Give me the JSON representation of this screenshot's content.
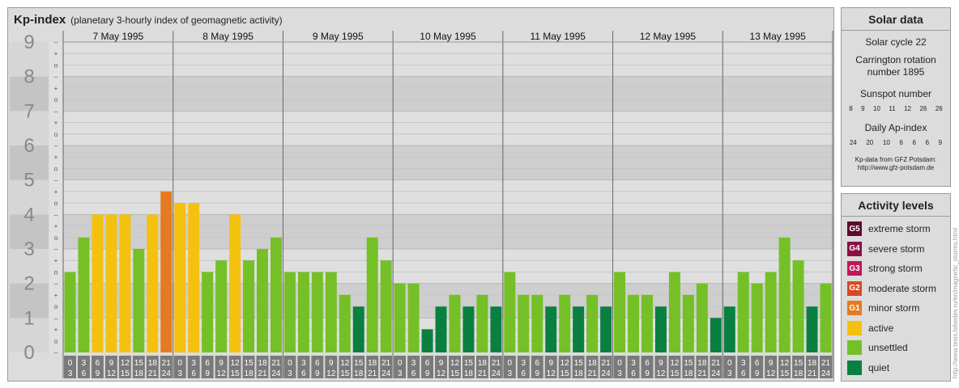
{
  "header": {
    "title": "Kp-index",
    "subtitle": "(planetary 3-hourly index of geomagnetic activity)"
  },
  "solar": {
    "title": "Solar data",
    "solar_cycle": "Solar cycle 22",
    "carrington": "Carrington rotation number 1895",
    "sunspot_label": "Sunspot number",
    "sunspot_values": [
      "8",
      "9",
      "10",
      "11",
      "12",
      "26",
      "26"
    ],
    "ap_label": "Daily Ap-index",
    "ap_values": [
      "24",
      "20",
      "10",
      "6",
      "6",
      "6",
      "9"
    ],
    "credit_1": "Kp-data from GFZ Potsdam:",
    "credit_2": "http://www.gfz-potsdam.de"
  },
  "activity": {
    "title": "Activity levels",
    "levels": [
      {
        "badge": "G5",
        "label": "extreme storm",
        "color": "#5c0a2e"
      },
      {
        "badge": "G4",
        "label": "severe storm",
        "color": "#8c1048"
      },
      {
        "badge": "G3",
        "label": "strong storm",
        "color": "#c0175c"
      },
      {
        "badge": "G2",
        "label": "moderate storm",
        "color": "#d64a24"
      },
      {
        "badge": "G1",
        "label": "minor storm",
        "color": "#e57a1e"
      },
      {
        "badge": "",
        "label": "active",
        "color": "#f5c10f"
      },
      {
        "badge": "",
        "label": "unsettled",
        "color": "#74c026"
      },
      {
        "badge": "",
        "label": "quiet",
        "color": "#0a8040"
      }
    ]
  },
  "vertical_credit": "http://www.tesis.lebedev.ru/en/magnetic_storms.html",
  "chart_data": {
    "type": "bar",
    "y_range": [
      0,
      9
    ],
    "y_ticks": [
      "0",
      "1",
      "2",
      "3",
      "4",
      "5",
      "6",
      "7",
      "8",
      "9"
    ],
    "minor_tick_labels": [
      "–",
      "o",
      "+"
    ],
    "days": [
      "7 May 1995",
      "8 May 1995",
      "9 May 1995",
      "10 May 1995",
      "11 May 1995",
      "12 May 1995",
      "13 May 1995"
    ],
    "interval_start": [
      "0",
      "3",
      "6",
      "9",
      "12",
      "15",
      "18",
      "21"
    ],
    "interval_end": [
      "3",
      "6",
      "9",
      "12",
      "15",
      "18",
      "21",
      "24"
    ],
    "values": [
      2.33,
      3.33,
      4.0,
      4.0,
      4.0,
      3.0,
      4.0,
      4.67,
      4.33,
      4.33,
      2.33,
      2.67,
      4.0,
      2.67,
      3.0,
      3.33,
      2.33,
      2.33,
      2.33,
      2.33,
      1.67,
      1.33,
      3.33,
      2.67,
      2.0,
      2.0,
      0.67,
      1.33,
      1.67,
      1.33,
      1.67,
      1.33,
      2.33,
      1.67,
      1.67,
      1.33,
      1.67,
      1.33,
      1.67,
      1.33,
      2.33,
      1.67,
      1.67,
      1.33,
      2.33,
      1.67,
      2.0,
      1.0,
      1.33,
      2.33,
      2.0,
      2.33,
      3.33,
      2.67,
      1.33,
      2.0
    ],
    "colors": {
      "quiet": "#0a8040",
      "unsettled": "#74c026",
      "active": "#f5c10f",
      "minor_storm": "#e57a1e"
    }
  }
}
